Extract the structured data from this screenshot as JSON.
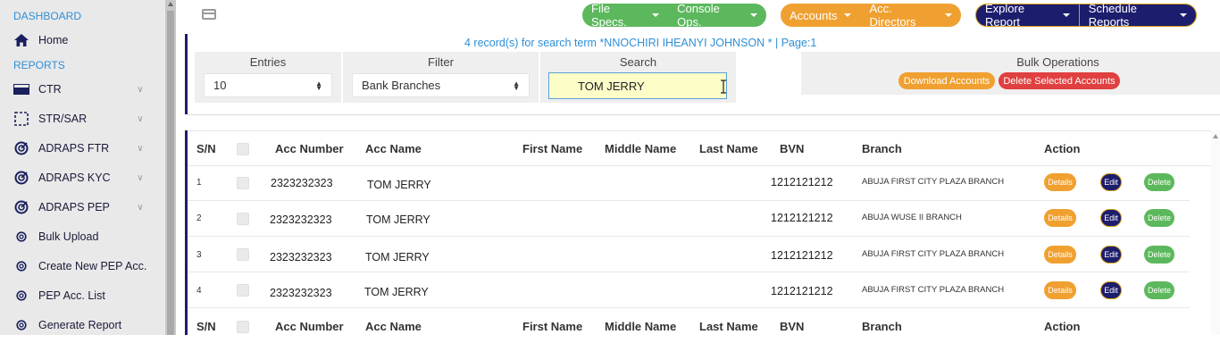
{
  "sidebar": {
    "sections": [
      "DASHBOARD",
      "REPORTS"
    ],
    "items": [
      {
        "label": "Home",
        "icon": "home-icon",
        "chevron": false
      },
      {
        "label": "CTR",
        "icon": "tray-icon",
        "chevron": true
      },
      {
        "label": "STR/SAR",
        "icon": "dashed-box-icon",
        "chevron": true
      },
      {
        "label": "ADRAPS FTR",
        "icon": "radar-icon",
        "chevron": true
      },
      {
        "label": "ADRAPS KYC",
        "icon": "radar-icon",
        "chevron": true
      },
      {
        "label": "ADRAPS PEP",
        "icon": "radar-icon",
        "chevron": true
      },
      {
        "label": "Bulk Upload",
        "icon": "radar-small-icon",
        "chevron": false
      },
      {
        "label": "Create New PEP Acc.",
        "icon": "radar-small-icon",
        "chevron": false
      },
      {
        "label": "PEP Acc. List",
        "icon": "radar-small-icon",
        "chevron": false
      },
      {
        "label": "Generate Report",
        "icon": "radar-small-icon",
        "chevron": false
      }
    ]
  },
  "topbar": {
    "menus": [
      {
        "label": "File Specs.",
        "group": "green"
      },
      {
        "label": "Console Ops.",
        "group": "green"
      },
      {
        "label": "Accounts",
        "group": "orange"
      },
      {
        "label": "Acc. Directors",
        "group": "orange"
      },
      {
        "label": "Explore Report",
        "group": "navy"
      },
      {
        "label": "Schedule Reports",
        "group": "navy"
      }
    ]
  },
  "filters": {
    "record_info": "4 record(s) for search term *NNOCHIRI IHEANYI JOHNSON * | Page:1",
    "entries_label": "Entries",
    "entries_value": "10",
    "filter_label": "Filter",
    "filter_value": "Bank Branches",
    "search_label": "Search",
    "search_value": "TOM JERRY",
    "bulk_label": "Bulk Operations",
    "download_label": "Download Accounts",
    "delete_selected_label": "Delete Selected Accounts"
  },
  "table": {
    "headers": [
      "S/N",
      "Acc Number",
      "Acc Name",
      "First Name",
      "Middle Name",
      "Last Name",
      "BVN",
      "Branch",
      "Action"
    ],
    "rows": [
      {
        "sn": "1",
        "acc_number": "2323232323",
        "acc_name": "TOM JERRY",
        "first_name": "",
        "middle_name": "",
        "last_name": "",
        "bvn": "1212121212",
        "branch": "ABUJA FIRST CITY PLAZA BRANCH"
      },
      {
        "sn": "2",
        "acc_number": "2323232323",
        "acc_name": "TOM JERRY",
        "first_name": "",
        "middle_name": "",
        "last_name": "",
        "bvn": "1212121212",
        "branch": "ABUJA WUSE II BRANCH"
      },
      {
        "sn": "3",
        "acc_number": "2323232323",
        "acc_name": "TOM JERRY",
        "first_name": "",
        "middle_name": "",
        "last_name": "",
        "bvn": "1212121212",
        "branch": "ABUJA FIRST CITY PLAZA BRANCH"
      },
      {
        "sn": "4",
        "acc_number": "2323232323",
        "acc_name": "TOM JERRY",
        "first_name": "",
        "middle_name": "",
        "last_name": "",
        "bvn": "1212121212",
        "branch": "ABUJA FIRST CITY PLAZA BRANCH"
      }
    ],
    "action_labels": {
      "details": "Details",
      "edit": "Edit",
      "delete": "Delete"
    }
  },
  "colors": {
    "accent_blue": "#2f8fd6",
    "navy": "#1d1d6e",
    "green": "#5cb85c",
    "orange": "#f0a030",
    "red": "#e04040"
  }
}
